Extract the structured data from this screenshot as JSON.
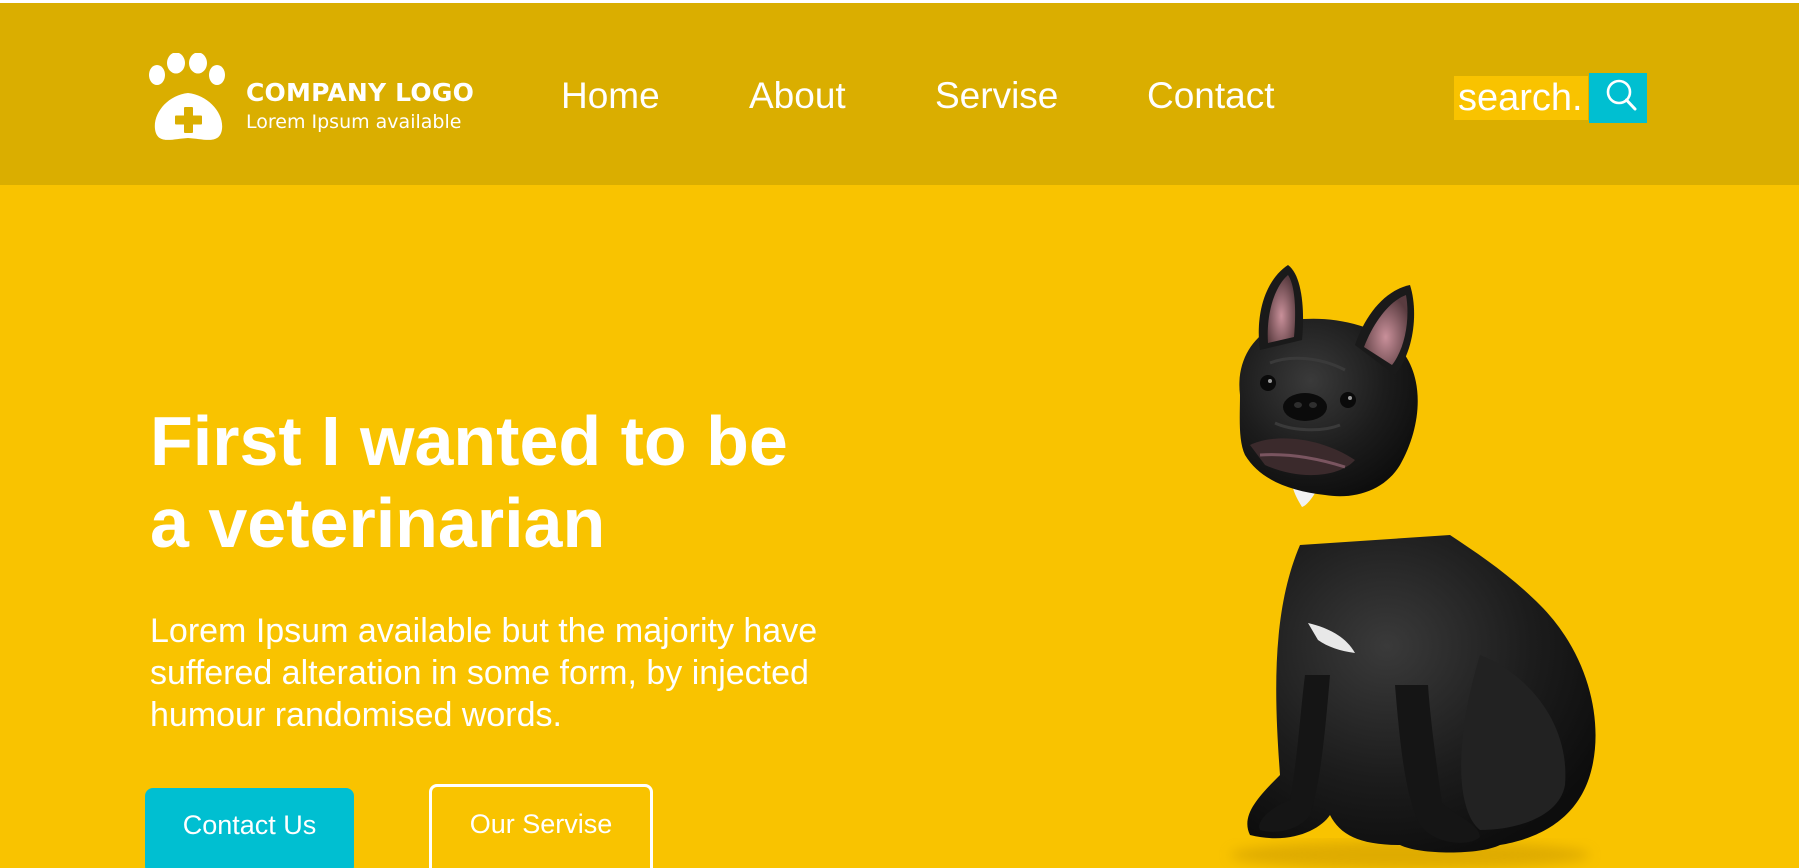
{
  "colors": {
    "header_bg": "#DAAE00",
    "hero_bg": "#F9C300",
    "accent": "#00BFD1",
    "text": "#FFFFFF"
  },
  "logo": {
    "icon": "paw-plus-icon",
    "title": "COMPANY LOGO",
    "subtitle": "Lorem Ipsum available"
  },
  "nav": {
    "items": [
      {
        "label": "Home"
      },
      {
        "label": "About"
      },
      {
        "label": "Servise"
      },
      {
        "label": "Contact"
      }
    ]
  },
  "search": {
    "placeholder": "search.",
    "icon": "search-icon"
  },
  "hero": {
    "title_line1": "First I wanted to be",
    "title_line2": "a veterinarian",
    "text_line1": "Lorem Ipsum available but the majority have",
    "text_line2": "suffered alteration in some form, by injected",
    "text_line3": "humour randomised words.",
    "primary_button": "Contact Us",
    "secondary_button": "Our Servise",
    "image": "french-bulldog-image"
  }
}
